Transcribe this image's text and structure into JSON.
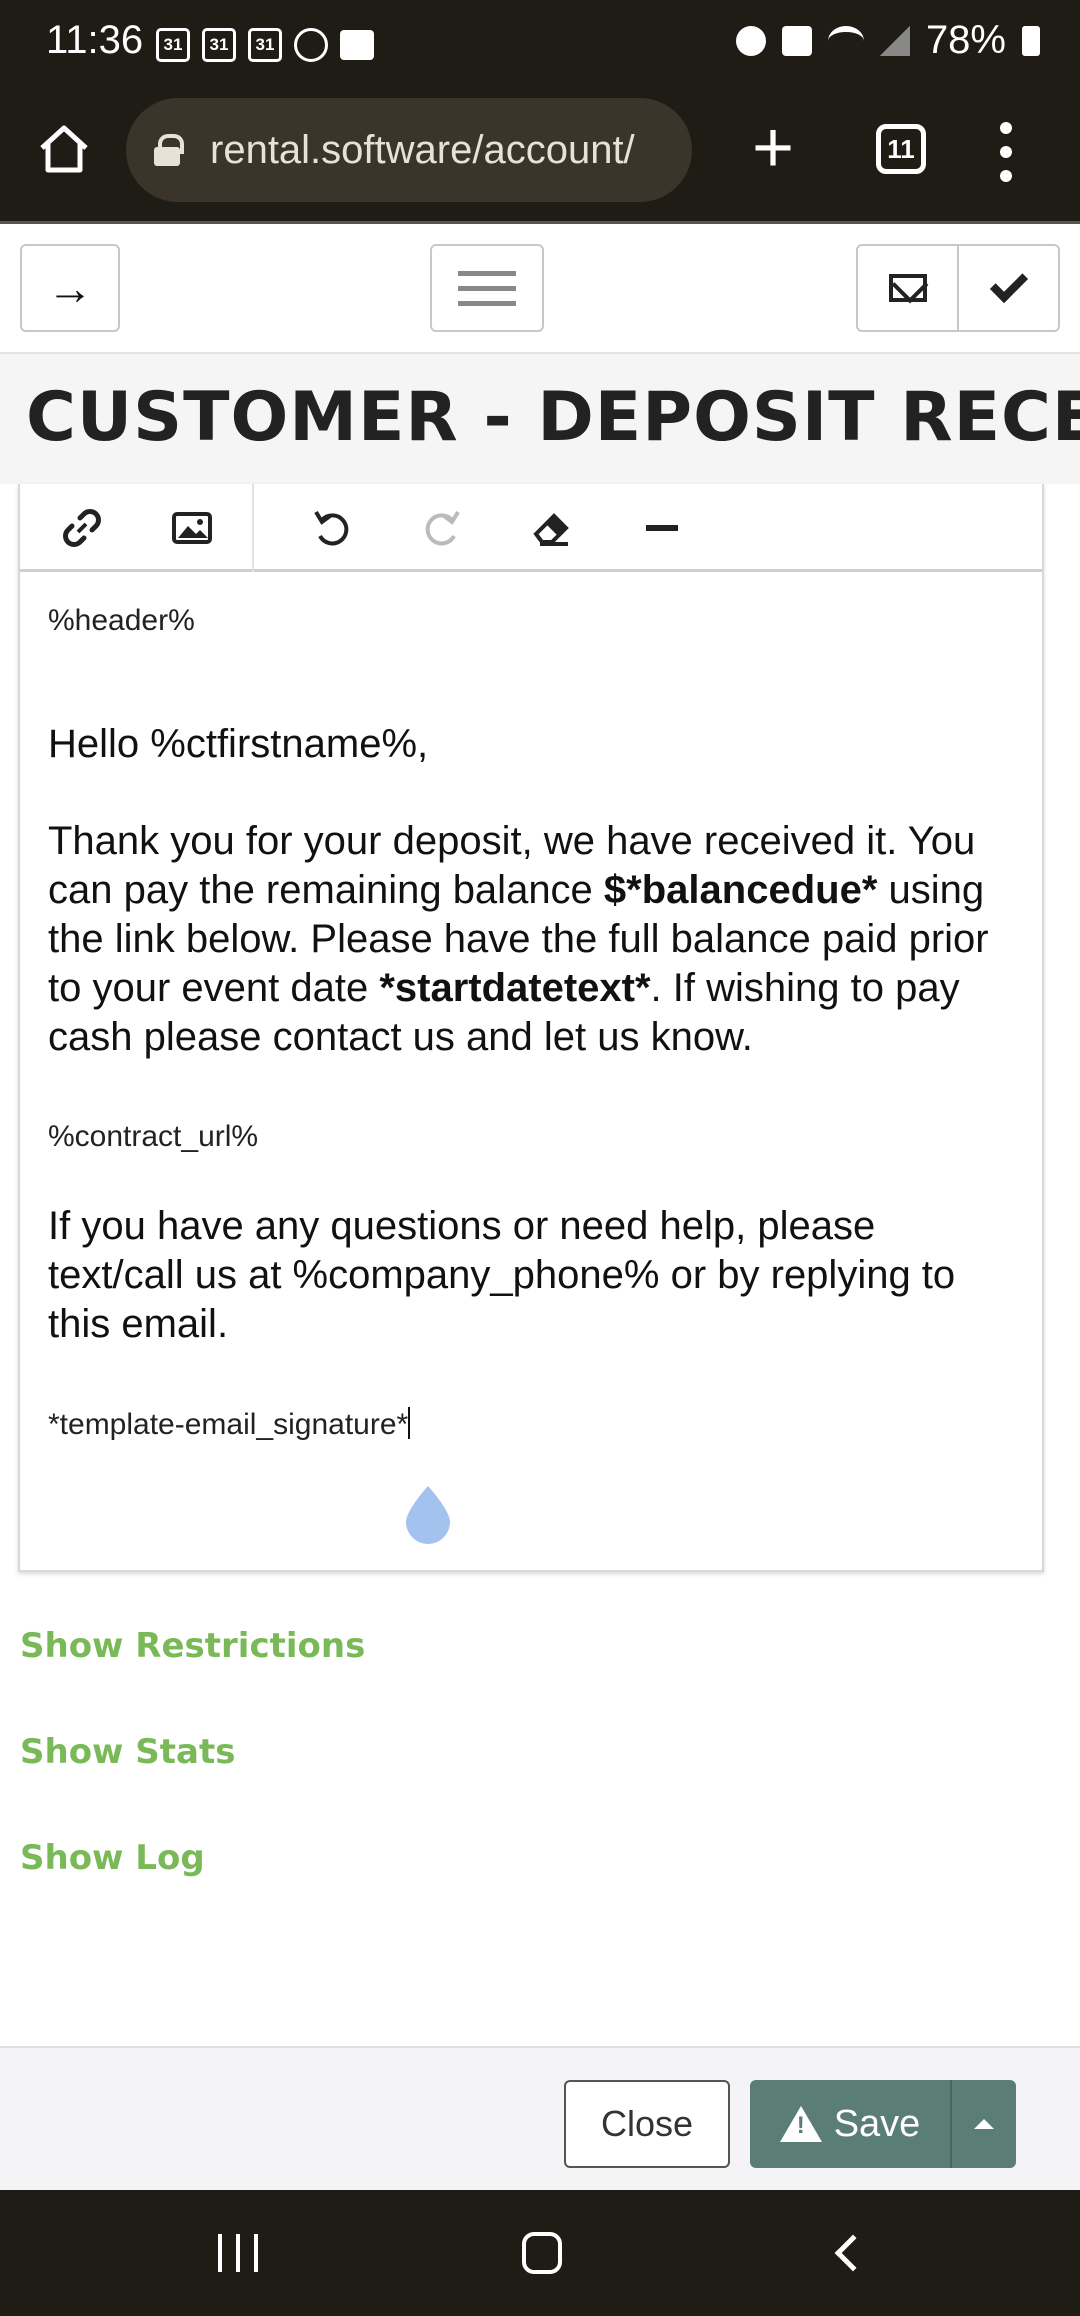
{
  "status_bar": {
    "time": "11:36",
    "calendar_icon_labels": [
      "31",
      "31",
      "31"
    ],
    "battery": "78%"
  },
  "browser": {
    "url": "rental.software/account/",
    "tab_count": "11"
  },
  "page": {
    "title": "CUSTOMER - DEPOSIT RECEIVED"
  },
  "editor": {
    "header_token": "%header%",
    "greeting": "Hello %ctfirstname%,",
    "para1_a": "Thank you for your deposit, we have received it. You can pay the remaining balance ",
    "para1_b": "$*balancedue*",
    "para1_c": " using the link below. Please have the full balance paid prior to your event date ",
    "para1_d": "*startdatetext*",
    "para1_e": ". If wishing to pay cash please contact us and let us know.",
    "contract_token": "%contract_url%",
    "para2": "If you have any questions or need help, please text/call us at %company_phone% or by replying to this email.",
    "signature_token": "*template-email_signature*"
  },
  "links": {
    "restrictions": "Show Restrictions",
    "stats": "Show Stats",
    "log": "Show Log"
  },
  "actions": {
    "close": "Close",
    "save": "Save"
  },
  "colors": {
    "link_green": "#7ab957",
    "save_button": "#5a7e76",
    "chrome_dark": "#1f1c16"
  }
}
